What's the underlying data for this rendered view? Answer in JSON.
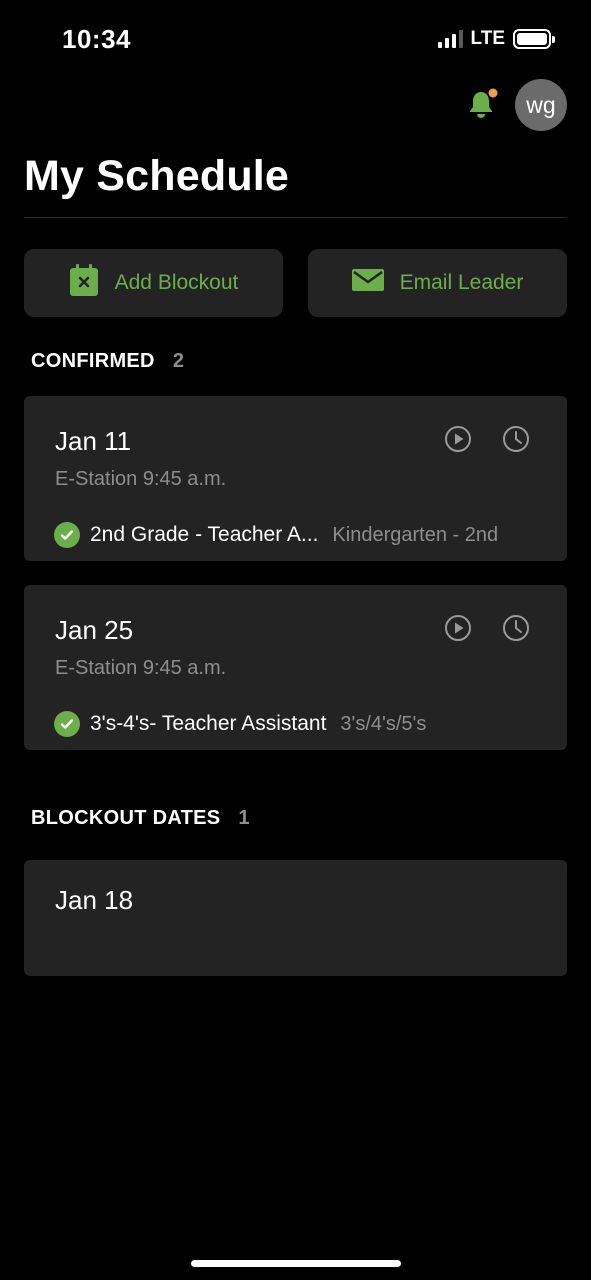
{
  "status_bar": {
    "time": "10:34",
    "carrier": "LTE"
  },
  "header": {
    "avatar_initials": "wg",
    "title": "My Schedule",
    "bell_badge_color": "#f0a04b"
  },
  "actions": {
    "add_blockout": "Add Blockout",
    "email_leader": "Email Leader"
  },
  "confirmed": {
    "title": "CONFIRMED",
    "count": "2",
    "items": [
      {
        "date": "Jan 11",
        "location": "E-Station 9:45 a.m.",
        "role": "2nd Grade - Teacher A...",
        "team": "Kindergarten - 2nd"
      },
      {
        "date": "Jan 25",
        "location": "E-Station 9:45 a.m.",
        "role": "3's-4's- Teacher Assistant",
        "team": "3's/4's/5's"
      }
    ]
  },
  "blockouts": {
    "title": "BLOCKOUT DATES",
    "count": "1",
    "items": [
      {
        "date": "Jan 18"
      }
    ]
  },
  "colors": {
    "accent": "#6cae4b",
    "card_bg": "#232323",
    "muted_text": "#8e8e8e"
  },
  "icons": {
    "bell": "bell-icon",
    "add_blockout": "calendar-x-icon",
    "email": "envelope-icon",
    "play": "play-circle-icon",
    "clock": "clock-icon",
    "check": "check-circle-icon"
  }
}
